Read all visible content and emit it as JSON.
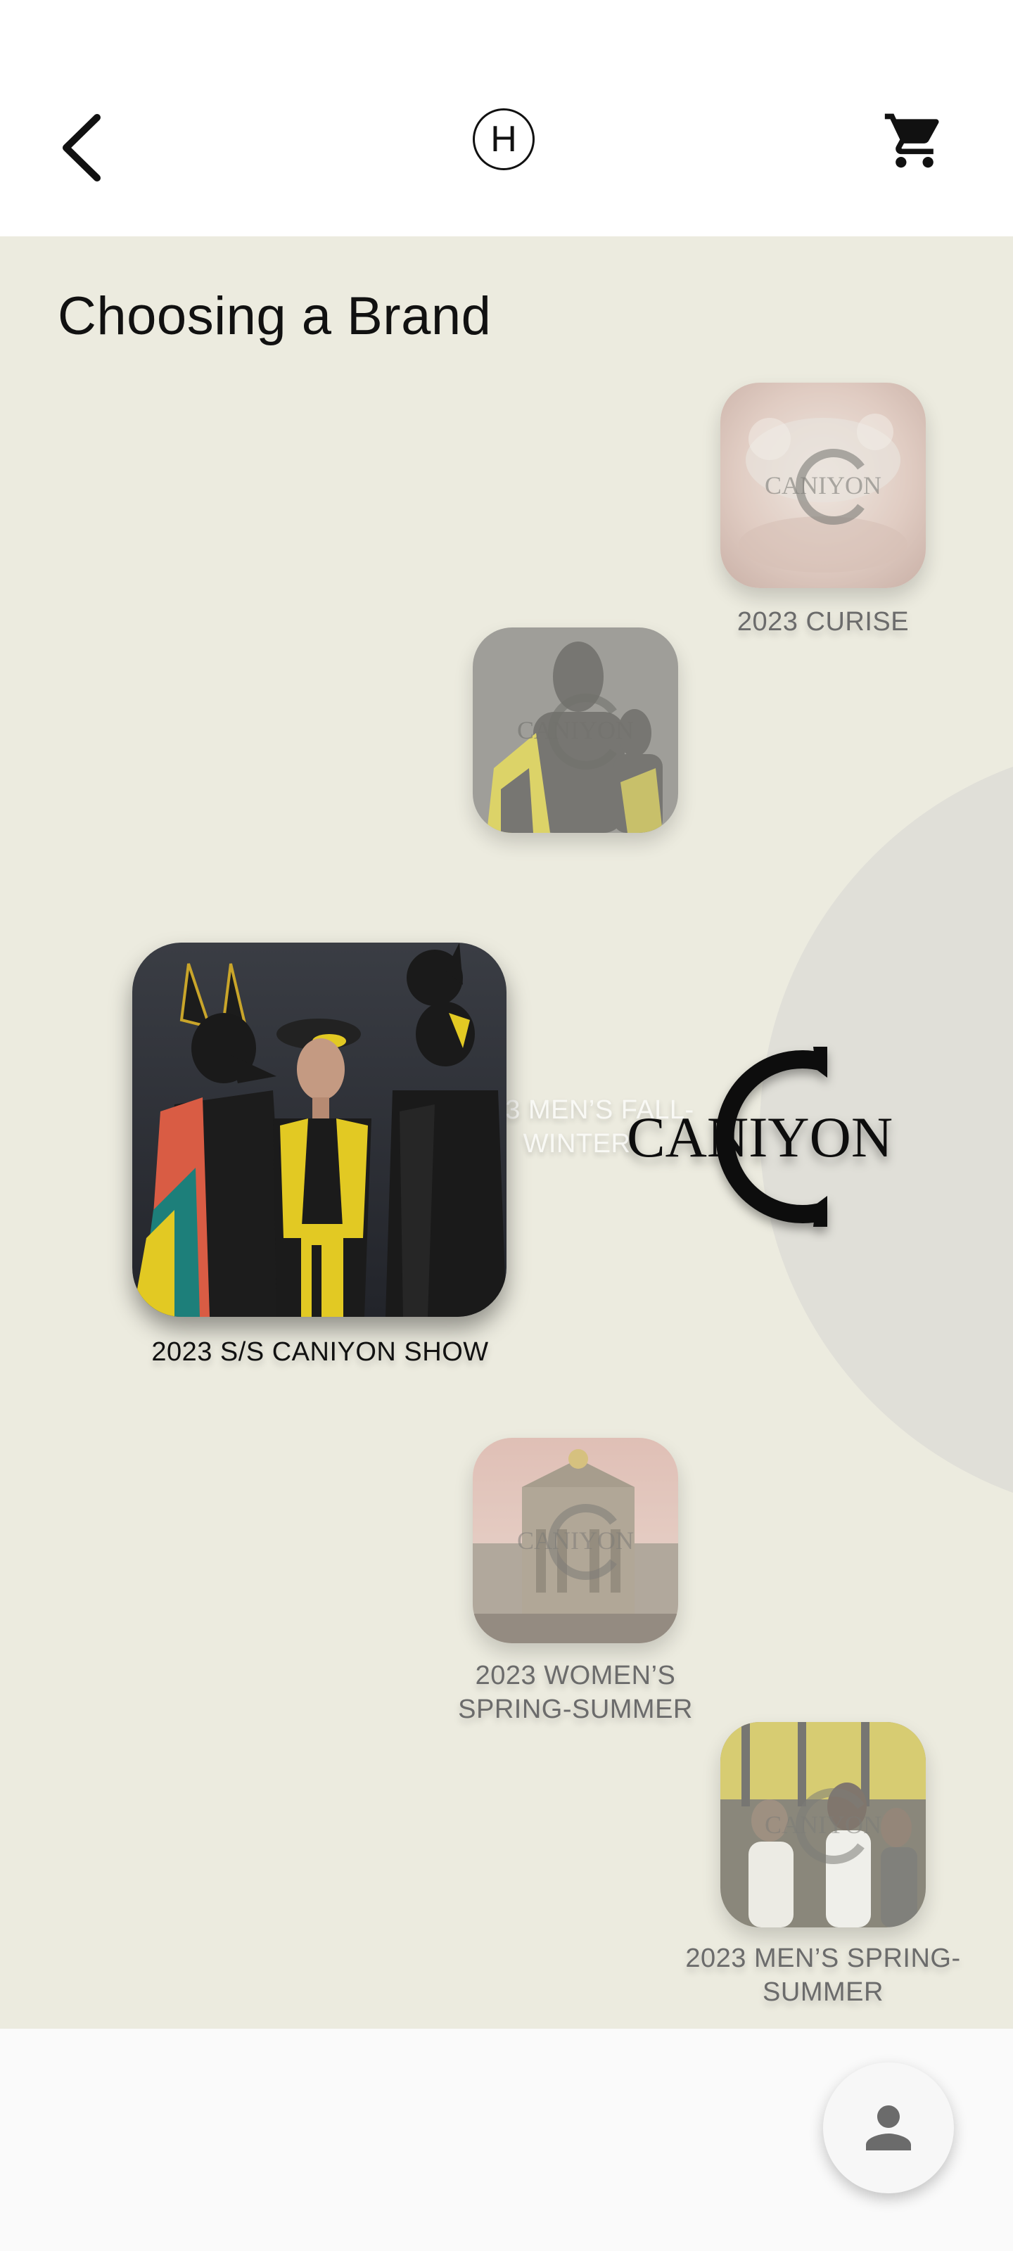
{
  "header": {
    "logo_letter": "H"
  },
  "page": {
    "title": "Choosing a Brand"
  },
  "brand": {
    "name": "CANIYON"
  },
  "collections": [
    {
      "label": "2023 CURISE",
      "state": "inactive"
    },
    {
      "label": "2023 MEN’S FALL-WINTER",
      "state": "ghost"
    },
    {
      "label": "2023 S/S CANIYON SHOW",
      "state": "selected"
    },
    {
      "label": "2023 WOMEN’S SPRING-SUMMER",
      "state": "inactive"
    },
    {
      "label": "2023 MEN’S SPRING-SUMMER",
      "state": "inactive"
    }
  ],
  "icons": {
    "back": "chevron-left-icon",
    "cart": "shopping-cart-icon",
    "profile": "person-icon"
  },
  "colors": {
    "background": "#ecebdf",
    "arc": "#e0dfd8",
    "text": "#111111"
  }
}
